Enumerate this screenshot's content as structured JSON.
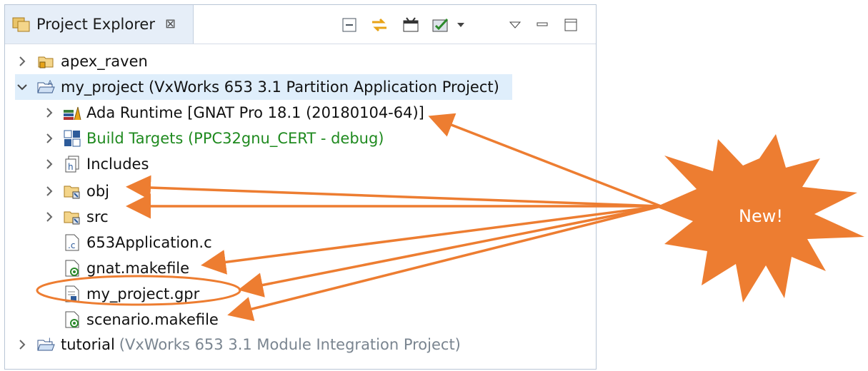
{
  "panel": {
    "tab_title": "Project Explorer",
    "close_symbol": "⊠"
  },
  "tree": [
    {
      "label": "apex_raven",
      "suffix": ""
    },
    {
      "label": "my_project (VxWorks 653 3.1 Partition Application Project)",
      "suffix": ""
    },
    {
      "label": "Ada Runtime [GNAT Pro 18.1 (20180104-64)]",
      "suffix": ""
    },
    {
      "label": "Build Targets (PPC32gnu_CERT - debug)",
      "suffix": ""
    },
    {
      "label": "Includes",
      "suffix": ""
    },
    {
      "label": "obj",
      "suffix": ""
    },
    {
      "label": "src",
      "suffix": ""
    },
    {
      "label": "653Application.c",
      "suffix": ""
    },
    {
      "label": "gnat.makefile",
      "suffix": ""
    },
    {
      "label": "my_project.gpr",
      "suffix": ""
    },
    {
      "label": "scenario.makefile",
      "suffix": ""
    },
    {
      "label": "tutorial",
      "suffix": "(VxWorks 653 3.1 Module Integration Project)"
    }
  ],
  "callout": {
    "text": "New!",
    "color": "#ED7D31"
  },
  "colors": {
    "selection": "#dfeefb",
    "green_text": "#1f8a1f",
    "muted_text": "#7a8590"
  }
}
